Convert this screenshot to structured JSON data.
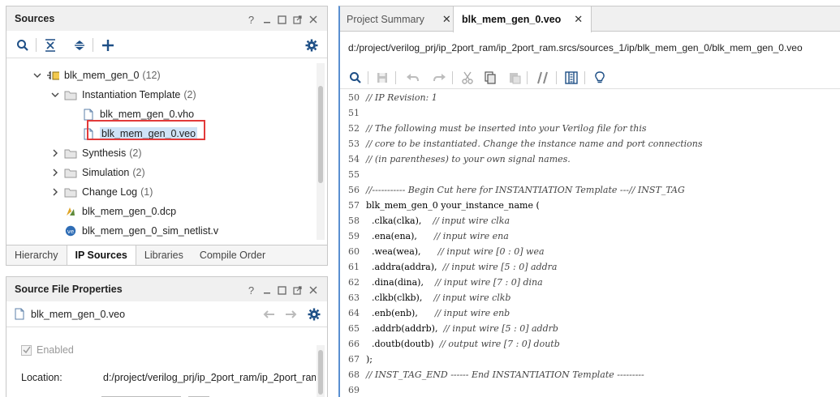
{
  "sources_panel": {
    "title": "Sources",
    "header_buttons": [
      "help-icon",
      "minimize-icon",
      "restore-icon",
      "float-icon",
      "close-icon"
    ],
    "toolbar": [
      "search-icon",
      "collapse-all-icon",
      "expand-all-icon",
      "add-icon",
      "gear-icon"
    ],
    "tree": [
      {
        "label": "blk_mem_gen_0",
        "count": "(12)",
        "icon": "ip-core-icon",
        "expanded": true
      },
      {
        "label": "Instantiation Template",
        "count": "(2)",
        "icon": "folder-icon",
        "expanded": true
      },
      {
        "label": "blk_mem_gen_0.vho",
        "count": "",
        "icon": "file-icon"
      },
      {
        "label": "blk_mem_gen_0.veo",
        "count": "",
        "icon": "file-icon",
        "selected": true
      },
      {
        "label": "Synthesis",
        "count": "(2)",
        "icon": "folder-icon",
        "expanded": false
      },
      {
        "label": "Simulation",
        "count": "(2)",
        "icon": "folder-icon",
        "expanded": false
      },
      {
        "label": "Change Log",
        "count": "(1)",
        "icon": "folder-icon",
        "expanded": false
      },
      {
        "label": "blk_mem_gen_0.dcp",
        "count": "",
        "icon": "checkpoint-icon"
      },
      {
        "label": "blk_mem_gen_0_sim_netlist.v",
        "count": "",
        "icon": "verilog-icon"
      }
    ],
    "tabs": [
      "Hierarchy",
      "IP Sources",
      "Libraries",
      "Compile Order"
    ],
    "active_tab": "IP Sources"
  },
  "props_panel": {
    "title": "Source File Properties",
    "file": "blk_mem_gen_0.veo",
    "enabled_label": "Enabled",
    "location_label": "Location:",
    "location_value": "d:/project/verilog_prj/ip_2port_ram/ip_2port_ram"
  },
  "editor": {
    "tabs": [
      {
        "label": "Project Summary",
        "active": false
      },
      {
        "label": "blk_mem_gen_0.veo",
        "active": true
      }
    ],
    "path": "d:/project/verilog_prj/ip_2port_ram/ip_2port_ram.srcs/sources_1/ip/blk_mem_gen_0/blk_mem_gen_0.veo",
    "toolbar": [
      "search-icon",
      "save-icon",
      "undo-icon",
      "redo-icon",
      "cut-icon",
      "copy-icon",
      "paste-icon",
      "comment-icon",
      "columns-icon",
      "lightbulb-icon"
    ],
    "lines": [
      {
        "n": "50",
        "code": "",
        "comment": "// IP Revision: 1"
      },
      {
        "n": "51",
        "code": "",
        "comment": ""
      },
      {
        "n": "52",
        "code": "",
        "comment": "// The following must be inserted into your Verilog file for this"
      },
      {
        "n": "53",
        "code": "",
        "comment": "// core to be instantiated. Change the instance name and port connections"
      },
      {
        "n": "54",
        "code": "",
        "comment": "// (in parentheses) to your own signal names."
      },
      {
        "n": "55",
        "code": "",
        "comment": ""
      },
      {
        "n": "56",
        "code": "",
        "comment": "//----------- Begin Cut here for INSTANTIATION Template ---// INST_TAG"
      },
      {
        "n": "57",
        "code": "blk_mem_gen_0 your_instance_name (",
        "comment": ""
      },
      {
        "n": "58",
        "code": "  .clka(clka),    ",
        "comment": "// input wire clka"
      },
      {
        "n": "59",
        "code": "  .ena(ena),      ",
        "comment": "// input wire ena"
      },
      {
        "n": "60",
        "code": "  .wea(wea),      ",
        "comment": "// input wire [0 : 0] wea"
      },
      {
        "n": "61",
        "code": "  .addra(addra),  ",
        "comment": "// input wire [5 : 0] addra"
      },
      {
        "n": "62",
        "code": "  .dina(dina),    ",
        "comment": "// input wire [7 : 0] dina"
      },
      {
        "n": "63",
        "code": "  .clkb(clkb),    ",
        "comment": "// input wire clkb"
      },
      {
        "n": "64",
        "code": "  .enb(enb),      ",
        "comment": "// input wire enb"
      },
      {
        "n": "65",
        "code": "  .addrb(addrb),  ",
        "comment": "// input wire [5 : 0] addrb"
      },
      {
        "n": "66",
        "code": "  .doutb(doutb)  ",
        "comment": "// output wire [7 : 0] doutb"
      },
      {
        "n": "67",
        "code": ");",
        "comment": ""
      },
      {
        "n": "68",
        "code": "",
        "comment": "// INST_TAG_END ------ End INSTANTIATION Template ---------"
      },
      {
        "n": "69",
        "code": "",
        "comment": ""
      }
    ]
  },
  "colors": {
    "accent": "#5a8fd0",
    "selection": "#cfe3f7",
    "highlight_box": "#e23a3a",
    "panel_header": "#f0f0f0"
  }
}
